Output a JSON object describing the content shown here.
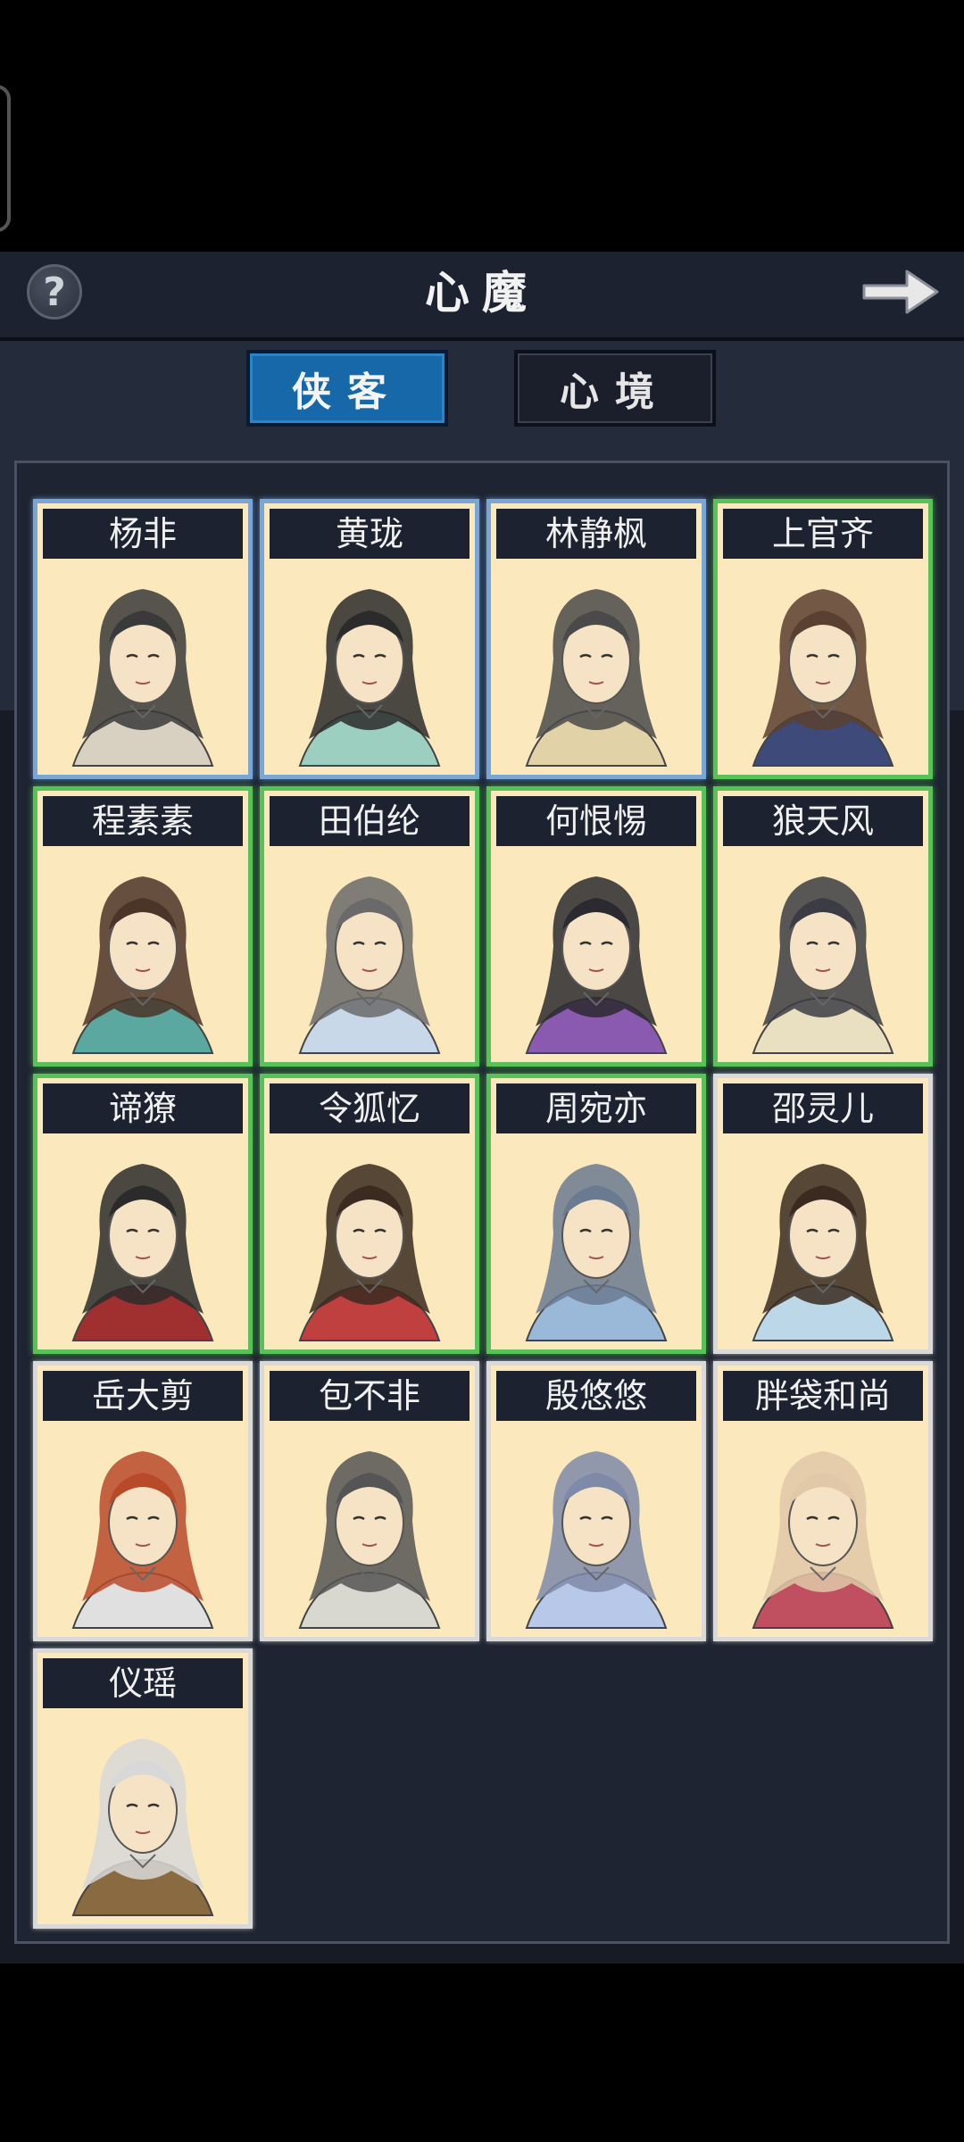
{
  "header": {
    "title": "心魔"
  },
  "tabs": [
    {
      "label": "侠客",
      "active": true
    },
    {
      "label": "心境",
      "active": false
    }
  ],
  "icons": {
    "help": "question-icon",
    "next": "arrow-right-icon"
  },
  "colors": {
    "blue_frame": "#7aa6d6",
    "green_frame": "#58c258",
    "gray_frame": "#d9d9d9",
    "card_bg": "#fbe8bd",
    "tab_active": "#1668a8"
  },
  "characters": [
    {
      "name": "杨非",
      "frame": "blue"
    },
    {
      "name": "黄珑",
      "frame": "blue"
    },
    {
      "name": "林静枫",
      "frame": "blue"
    },
    {
      "name": "上官齐",
      "frame": "green"
    },
    {
      "name": "程素素",
      "frame": "green"
    },
    {
      "name": "田伯纶",
      "frame": "green"
    },
    {
      "name": "何恨惕",
      "frame": "green"
    },
    {
      "name": "狼天风",
      "frame": "green"
    },
    {
      "name": "谛獠",
      "frame": "green"
    },
    {
      "name": "令狐忆",
      "frame": "green"
    },
    {
      "name": "周宛亦",
      "frame": "green"
    },
    {
      "name": "邵灵儿",
      "frame": "gray"
    },
    {
      "name": "岳大剪",
      "frame": "gray"
    },
    {
      "name": "包不非",
      "frame": "gray"
    },
    {
      "name": "殷悠悠",
      "frame": "gray"
    },
    {
      "name": "胖袋和尚",
      "frame": "gray"
    },
    {
      "name": "仪瑶",
      "frame": "gray"
    }
  ]
}
